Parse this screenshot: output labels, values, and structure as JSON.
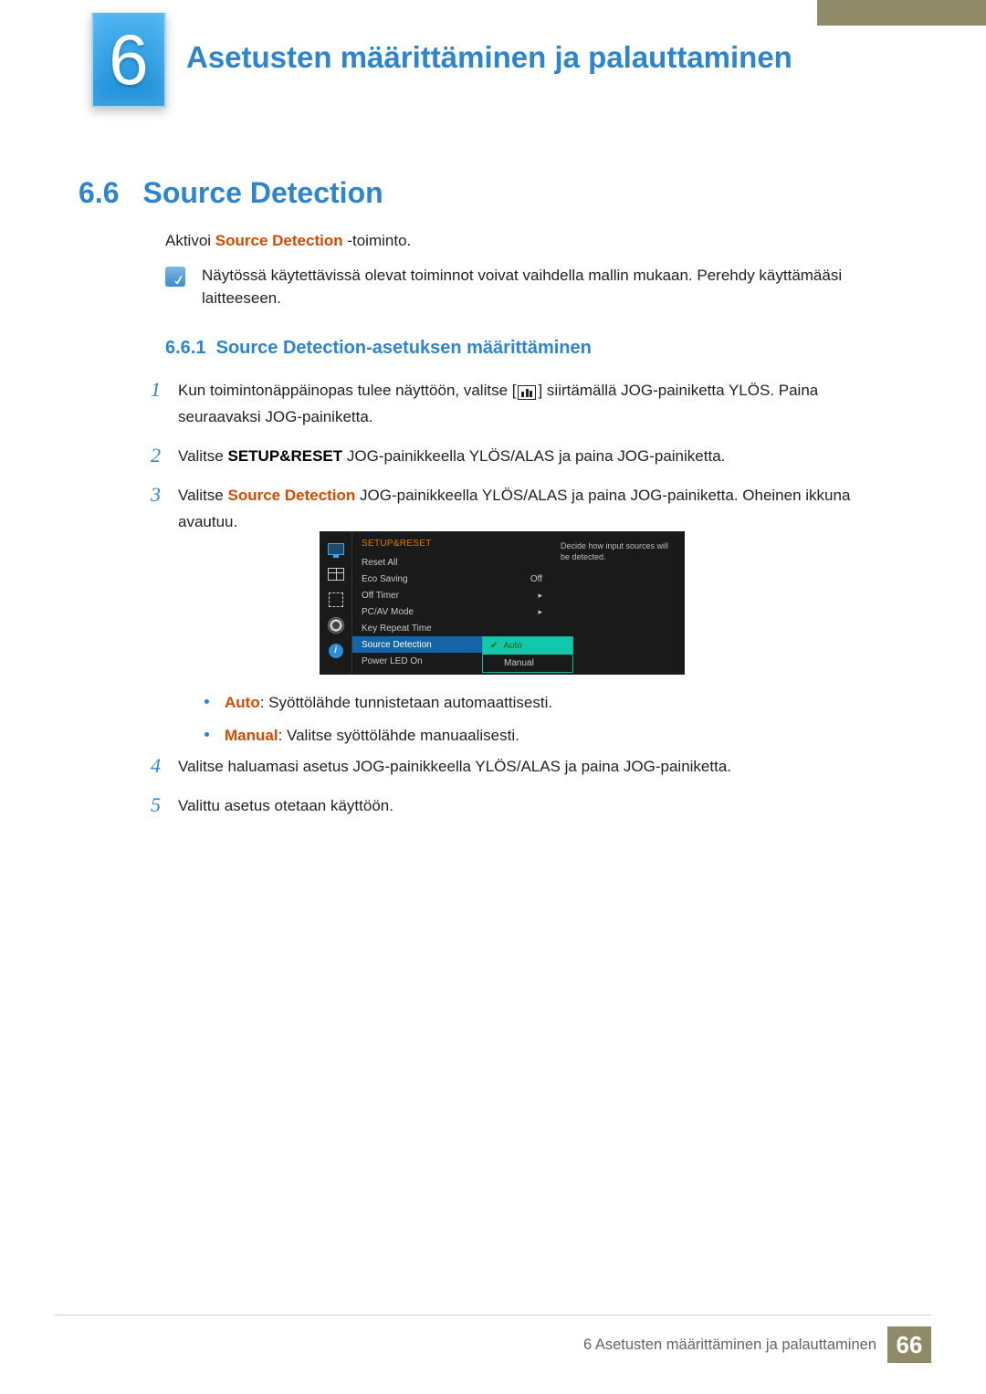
{
  "chapter": {
    "number": "6",
    "title": "Asetusten määrittäminen ja palauttaminen"
  },
  "section": {
    "number": "6.6",
    "title": "Source Detection"
  },
  "intro": {
    "prefix": "Aktivoi ",
    "feature": "Source Detection",
    "suffix": " -toiminto."
  },
  "note": "Näytössä käytettävissä olevat toiminnot voivat vaihdella mallin mukaan. Perehdy käyttämääsi laitteeseen.",
  "subsection": {
    "number": "6.6.1",
    "title": "Source Detection-asetuksen määrittäminen"
  },
  "steps": {
    "s1": {
      "n": "1",
      "a": "Kun toimintonäppäinopas tulee näyttöön, valitse [",
      "b": "] siirtämällä JOG-painiketta YLÖS. Paina seuraavaksi JOG-painiketta."
    },
    "s2": {
      "n": "2",
      "a": "Valitse ",
      "bold": "SETUP&RESET",
      "b": " JOG-painikkeella YLÖS/ALAS ja paina JOG-painiketta."
    },
    "s3": {
      "n": "3",
      "a": "Valitse ",
      "emph": "Source Detection",
      "b": " JOG-painikkeella YLÖS/ALAS ja paina JOG-painiketta. Oheinen ikkuna avautuu."
    },
    "s4": {
      "n": "4",
      "text": "Valitse haluamasi asetus JOG-painikkeella YLÖS/ALAS ja paina JOG-painiketta."
    },
    "s5": {
      "n": "5",
      "text": "Valittu asetus otetaan käyttöön."
    }
  },
  "osd": {
    "title": "SETUP&RESET",
    "rows": {
      "reset": "Reset All",
      "eco": "Eco Saving",
      "eco_val": "Off",
      "offtimer": "Off Timer",
      "pcav": "PC/AV Mode",
      "keyrepeat": "Key Repeat Time",
      "source": "Source Detection",
      "powerled": "Power LED On"
    },
    "options": {
      "auto": "Auto",
      "manual": "Manual"
    },
    "help": "Decide how input sources will be detected.",
    "info_glyph": "i"
  },
  "bullets": {
    "auto_label": "Auto",
    "auto_text": ": Syöttölähde tunnistetaan automaattisesti.",
    "manual_label": "Manual",
    "manual_text": ": Valitse syöttölähde manuaalisesti."
  },
  "footer": {
    "text": "6 Asetusten määrittäminen ja palauttaminen",
    "page": "66"
  }
}
